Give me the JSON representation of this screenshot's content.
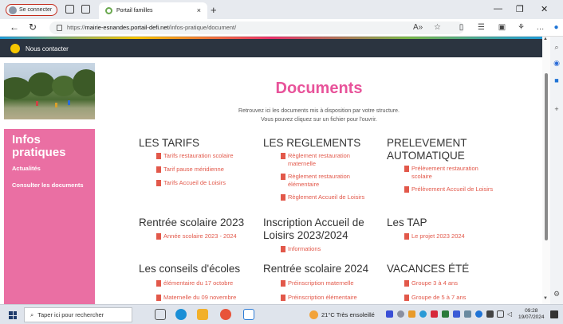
{
  "browser": {
    "signin_label": "Se connecter",
    "tab_title": "Portail familles",
    "tab_close": "×",
    "new_tab": "+",
    "url_prefix": "https://",
    "url_domain": "mairie-esnandes.portail-defi.net",
    "url_path": "/infos-pratique/document/",
    "read_aloud": "A»"
  },
  "header": {
    "contact_label": "Nous contacter"
  },
  "sidebar": {
    "title_line1": "Infos",
    "title_line2": "pratiques",
    "links": [
      "Actualités",
      "Consulter les documents"
    ]
  },
  "main": {
    "title": "Documents",
    "intro_line1": "Retrouvez ici les documents mis à disposition par votre structure.",
    "intro_line2": "Vous pouvez cliquez sur un fichier pour l'ouvrir.",
    "sections": [
      {
        "heading": "LES TARIFS",
        "items": [
          "Tarifs restauration scolaire",
          "Tarif pause méridienne",
          "Tarifs Accueil de Loisirs"
        ]
      },
      {
        "heading": "LES REGLEMENTS",
        "items": [
          "Règlement restauration maternelle",
          "Règlement restauration élémentaire",
          "Règlement Accueil de Loisirs"
        ]
      },
      {
        "heading_line1": "PRELEVEMENT",
        "heading_line2": "AUTOMATIQUE",
        "items": [
          "Prélèvement restauration scolaire",
          "Prélèvement Accueil de Loisirs"
        ]
      },
      {
        "heading": "Rentrée scolaire 2023",
        "items": [
          "Année scolaire 2023 - 2024"
        ]
      },
      {
        "heading_line1": "Inscription Accueil de",
        "heading_line2": "Loisirs 2023/2024",
        "items": [
          "Informations"
        ]
      },
      {
        "heading": "Les TAP",
        "items": [
          "Le projet 2023 2024"
        ]
      },
      {
        "heading": "Les conseils d'écoles",
        "items": [
          "élémentaire du 17 octobre",
          "Maternelle du 09 novembre"
        ]
      },
      {
        "heading": "Rentrée scolaire 2024",
        "items": [
          "Préinscription maternelle",
          "Préinscription élémentaire"
        ]
      },
      {
        "heading": "VACANCES ÉTÉ",
        "items": [
          "Groupe 3 à 4 ans",
          "Groupe de 5 à 7 ans"
        ]
      }
    ]
  },
  "taskbar": {
    "search_placeholder": "Taper ici pour rechercher",
    "weather": "21°C  Très ensoleillé",
    "time": "09:28",
    "date": "19/07/2024"
  },
  "colors": {
    "accent_pink": "#e8539a",
    "sidebar_pink": "#ea6fa3",
    "link_red": "#e2584a",
    "header_dark": "#2b3440"
  }
}
